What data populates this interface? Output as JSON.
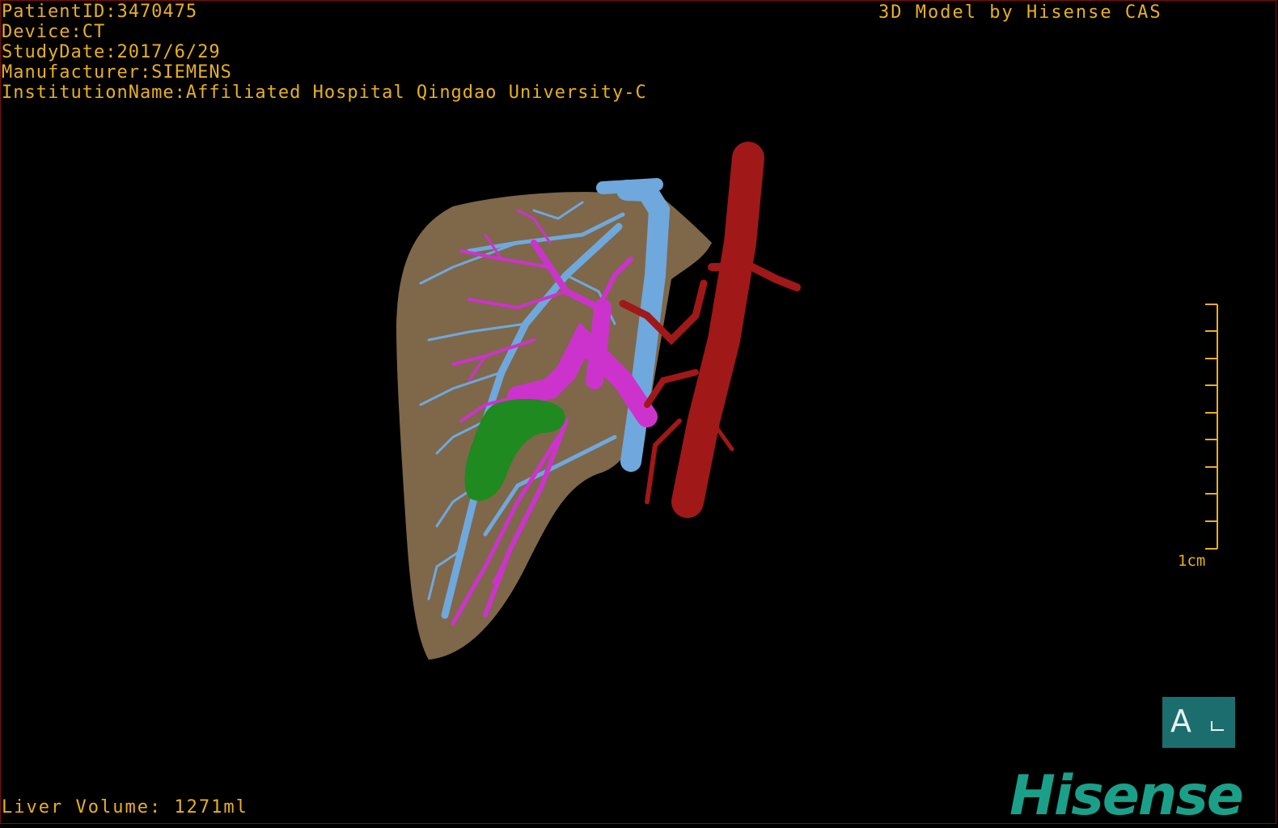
{
  "header": {
    "patient_id": "PatientID:3470475",
    "device": "Device:CT",
    "study_date": "StudyDate:2017/6/29",
    "manufacturer": "Manufacturer:SIEMENS",
    "institution": "InstitutionName:Affiliated Hospital Qingdao University-C"
  },
  "credit": "3D Model by Hisense CAS",
  "liver_volume": "Liver Volume: 1271ml",
  "scale": {
    "label": "1cm"
  },
  "orientation": {
    "letter": "A"
  },
  "brand": "Hisense",
  "colors": {
    "text": "#e8b020",
    "liver": "#8a7050",
    "hepatic_vein": "#6fa8dc",
    "portal_vein": "#cc33cc",
    "artery": "#a01818",
    "lesion": "#1f8a1f",
    "brand": "#1aa088",
    "orientation_box": "#1c6e6e"
  }
}
